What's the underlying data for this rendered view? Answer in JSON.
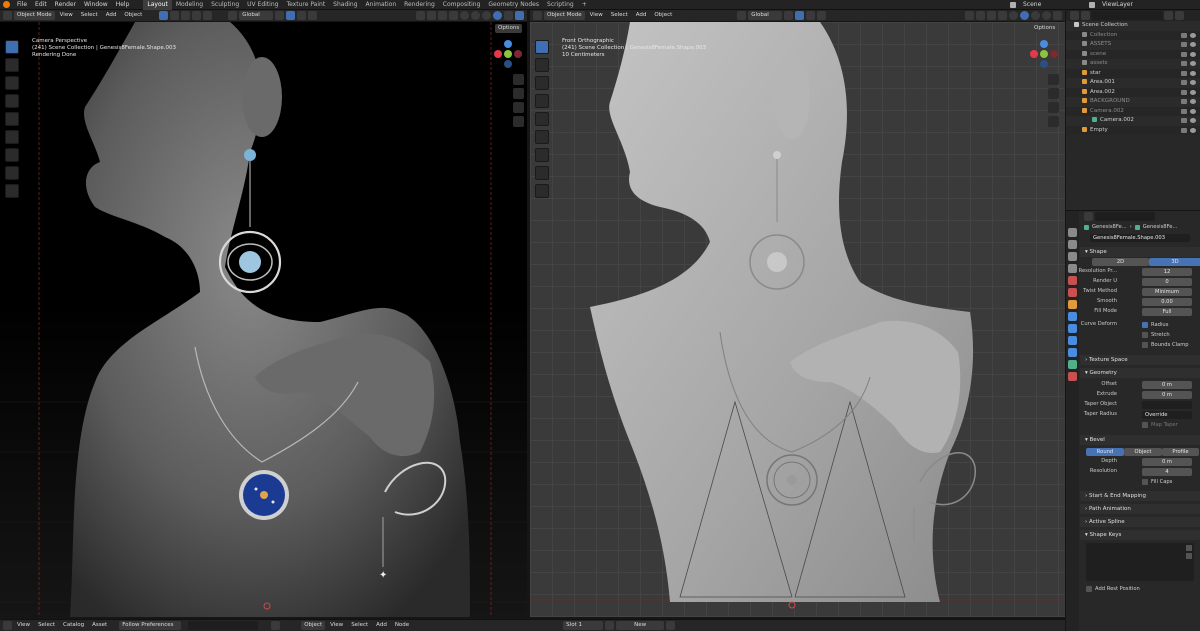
{
  "menu": {
    "items": [
      "File",
      "Edit",
      "Render",
      "Window",
      "Help"
    ],
    "workspaces": [
      "Layout",
      "Modeling",
      "Sculpting",
      "UV Editing",
      "Texture Paint",
      "Shading",
      "Animation",
      "Rendering",
      "Compositing",
      "Geometry Nodes",
      "Scripting",
      "+"
    ],
    "active_workspace": "Layout",
    "scene": "Scene",
    "view_layer": "ViewLayer"
  },
  "left_viewport": {
    "mode": "Object Mode",
    "menus": [
      "View",
      "Select",
      "Add",
      "Object"
    ],
    "transform": "Global",
    "options": "Options",
    "info": [
      "Camera Perspective",
      "(241) Scene Collection | Genesis8Female.Shape.003",
      "Rendering Done"
    ]
  },
  "right_viewport": {
    "mode": "Object Mode",
    "menus": [
      "View",
      "Select",
      "Add",
      "Object"
    ],
    "transform": "Global",
    "options": "Options",
    "info": [
      "Front Orthographic",
      "(241) Scene Collection | Genesis8Female.Shape.003",
      "10 Centimeters"
    ]
  },
  "bottom_bar": {
    "left_menus": [
      "View",
      "Select",
      "Catalog",
      "Asset"
    ],
    "follow": "Follow Preferences",
    "mid_menus": [
      "Object",
      "View",
      "Select",
      "Add",
      "Node"
    ],
    "slot": "Slot 1",
    "new_label": "New"
  },
  "outliner": {
    "root": "Scene Collection",
    "items": [
      {
        "label": "Collection",
        "style": "dim",
        "color": "#8a8a8a"
      },
      {
        "label": "ASSETS",
        "style": "dim",
        "color": "#8a8a8a"
      },
      {
        "label": "scene",
        "style": "dim",
        "color": "#8a8a8a"
      },
      {
        "label": "assets",
        "style": "dim",
        "color": "#8a8a8a"
      },
      {
        "label": "star",
        "style": "normal",
        "color": "#e09a3a"
      },
      {
        "label": "Area.001",
        "style": "normal",
        "color": "#e09a3a"
      },
      {
        "label": "Area.002",
        "style": "normal",
        "color": "#e09a3a"
      },
      {
        "label": "BACKGROUND",
        "style": "dim",
        "color": "#e09a3a"
      },
      {
        "label": "Camera.002",
        "style": "dim",
        "color": "#e09a3a"
      },
      {
        "label": "Camera.002",
        "style": "child",
        "color": "#4fb08a"
      },
      {
        "label": "Empty",
        "style": "normal",
        "color": "#e09a3a"
      }
    ]
  },
  "properties": {
    "breadcrumb": [
      "Genesis8Fe...",
      "Genesis8Fe..."
    ],
    "datablock": "Genesis8Female.Shape.003",
    "shape": {
      "header": "Shape",
      "dim_2d": "2D",
      "dim_3d": "3D",
      "fields": [
        {
          "label": "Resolution Pr...",
          "value": "12"
        },
        {
          "label": "Render U",
          "value": "0"
        },
        {
          "label": "Twist Method",
          "value": "Minimum"
        },
        {
          "label": "Smooth",
          "value": "0.00"
        },
        {
          "label": "Fill Mode",
          "value": "Full"
        }
      ],
      "curve_deform_label": "Curve Deform",
      "checks": [
        {
          "label": "Radius",
          "checked": true
        },
        {
          "label": "Stretch",
          "checked": false
        },
        {
          "label": "Bounds Clamp",
          "checked": false
        }
      ]
    },
    "texture_space": "Texture Space",
    "geometry": {
      "header": "Geometry",
      "fields": [
        {
          "label": "Offset",
          "value": "0 m"
        },
        {
          "label": "Extrude",
          "value": "0 m"
        }
      ],
      "taper_object_label": "Taper Object",
      "taper_radius_label": "Taper Radius",
      "taper_radius_value": "Override",
      "map_taper": "Map Taper"
    },
    "bevel": {
      "header": "Bevel",
      "modes": [
        "Round",
        "Object",
        "Profile"
      ],
      "active_mode": "Round",
      "depth_label": "Depth",
      "depth_value": "0 m",
      "resolution_label": "Resolution",
      "resolution_value": "4",
      "fill_caps": "Fill Caps"
    },
    "collapsed_panels": [
      "Start & End Mapping",
      "Path Animation",
      "Active Spline"
    ],
    "shape_keys": "Shape Keys",
    "add_rest_position": "Add Rest Position"
  },
  "colors": {
    "accent_blue": "#4772b3",
    "gizmo_x": "#e5394a",
    "gizmo_y": "#8bc43f",
    "gizmo_z": "#4a8de0"
  }
}
